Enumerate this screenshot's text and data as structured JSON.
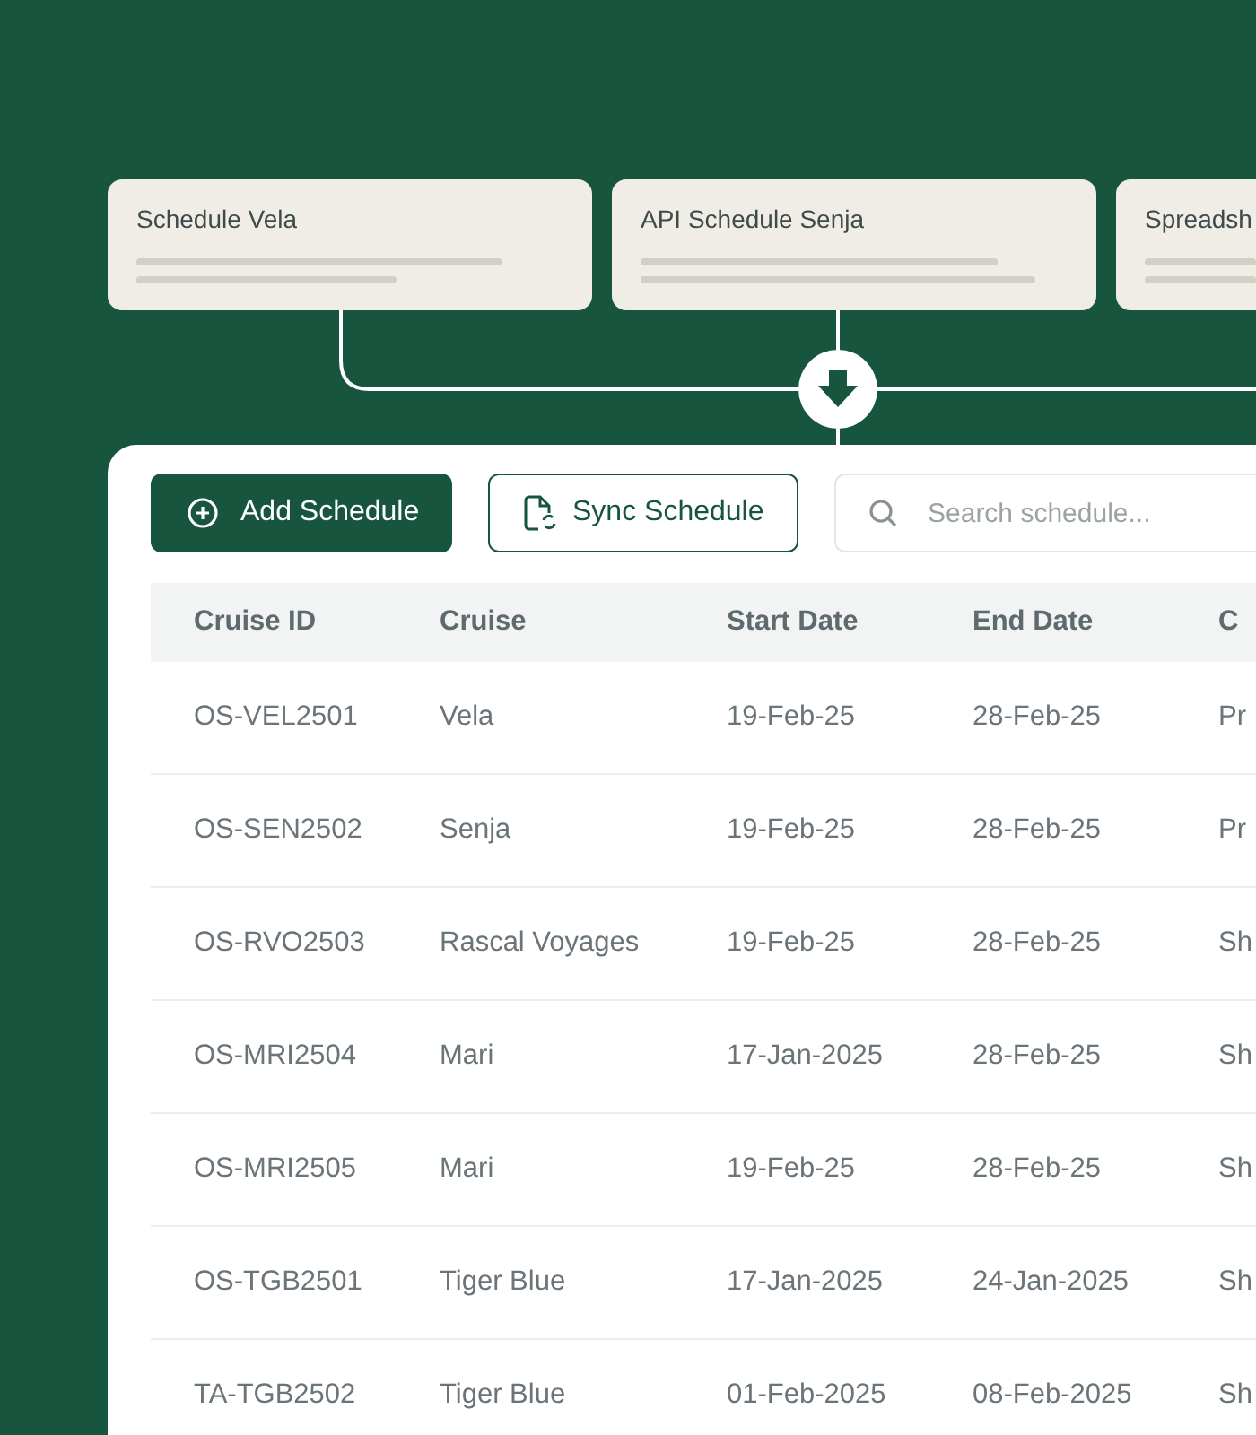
{
  "source_cards": [
    {
      "title": "Schedule Vela"
    },
    {
      "title": "API Schedule Senja"
    },
    {
      "title": "Spreadsh"
    }
  ],
  "toolbar": {
    "add_button": "Add Schedule",
    "sync_button": "Sync Schedule",
    "search": {
      "placeholder": "Search schedule..."
    }
  },
  "table": {
    "columns": [
      "Cruise ID",
      "Cruise",
      "Start Date",
      "End Date",
      "C"
    ],
    "rows": [
      [
        "OS-VEL2501",
        "Vela",
        "19-Feb-25",
        "28-Feb-25",
        "Pr"
      ],
      [
        "OS-SEN2502",
        "Senja",
        "19-Feb-25",
        "28-Feb-25",
        "Pr"
      ],
      [
        "OS-RVO2503",
        "Rascal Voyages",
        "19-Feb-25",
        "28-Feb-25",
        "Sh"
      ],
      [
        "OS-MRI2504",
        "Mari",
        "17-Jan-2025",
        "28-Feb-25",
        "Sh"
      ],
      [
        "OS-MRI2505",
        "Mari",
        "19-Feb-25",
        "28-Feb-25",
        "Sh"
      ],
      [
        "OS-TGB2501",
        "Tiger Blue",
        "17-Jan-2025",
        "24-Jan-2025",
        "Sh"
      ],
      [
        "TA-TGB2502",
        "Tiger Blue",
        "01-Feb-2025",
        "08-Feb-2025",
        "Sh"
      ]
    ]
  }
}
